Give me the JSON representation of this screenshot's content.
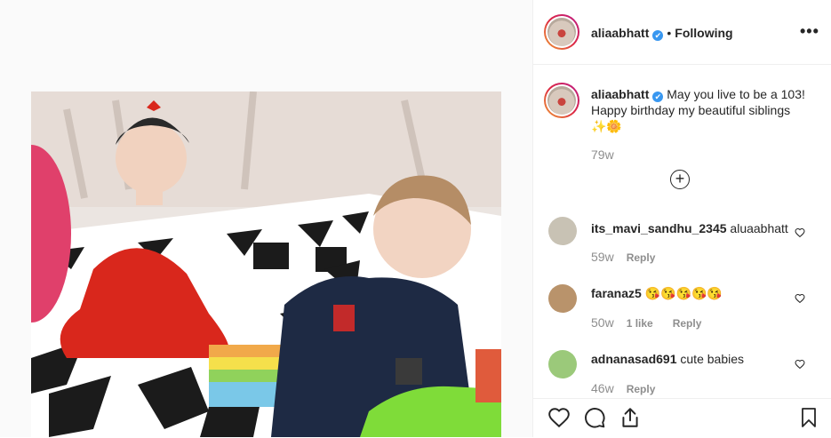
{
  "post": {
    "username": "aliaabhatt",
    "verified_mark": "✔",
    "dot": "•",
    "following_label": "Following",
    "more_label": "•••",
    "caption": "May you live to be a 103! Happy birthday my beautiful siblings",
    "caption_emojis": "✨🌼",
    "timestamp": "79w",
    "load_more_icon": "plus-circle-icon"
  },
  "comments": [
    {
      "username": "its_mavi_sandhu_2345",
      "text": "aluaabhatt",
      "time": "59w",
      "likes": "",
      "reply": "Reply",
      "avatar_color": "#c8c2b4"
    },
    {
      "username": "faranaz5",
      "text": "😘😘😘😘😘",
      "time": "50w",
      "likes": "1 like",
      "reply": "Reply",
      "avatar_color": "#b9936b"
    },
    {
      "username": "adnanasad691",
      "text": "cute babies",
      "time": "46w",
      "likes": "",
      "reply": "Reply",
      "avatar_color": "#9bc97a"
    }
  ],
  "actions": {
    "like_icon": "heart-icon",
    "comment_icon": "comment-icon",
    "share_icon": "share-icon",
    "save_icon": "bookmark-icon"
  },
  "colors": {
    "verified": "#3897f0",
    "muted": "#8e8e8e",
    "text": "#262626"
  }
}
